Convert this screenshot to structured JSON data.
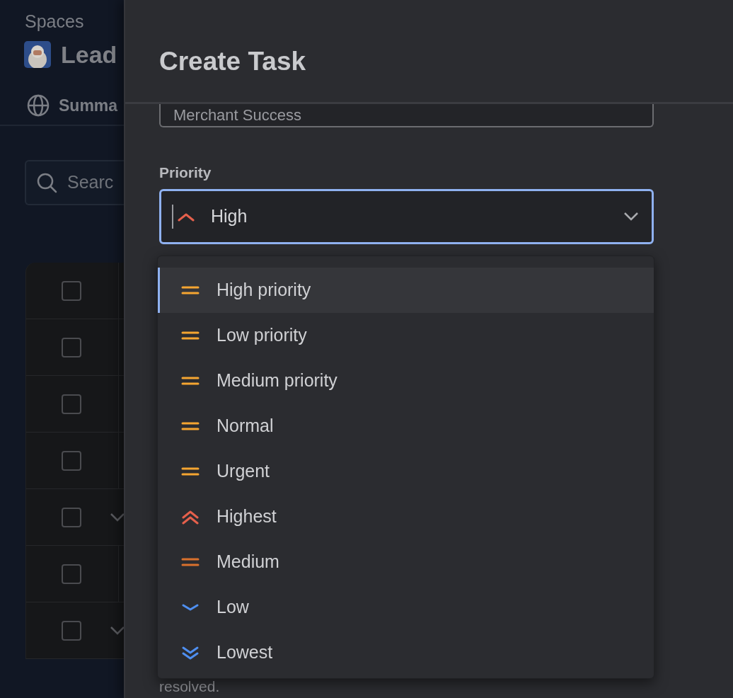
{
  "background": {
    "breadcrumb": "Spaces",
    "space_title": "Lead",
    "tab": "Summa",
    "search_placeholder": "Searc",
    "table_rows": [
      {
        "checked": false,
        "expandable": false
      },
      {
        "checked": false,
        "expandable": false
      },
      {
        "checked": false,
        "expandable": false
      },
      {
        "checked": false,
        "expandable": false
      },
      {
        "checked": false,
        "expandable": true
      },
      {
        "checked": false,
        "expandable": false
      },
      {
        "checked": false,
        "expandable": true
      }
    ]
  },
  "modal": {
    "title": "Create Task",
    "field_value": "Merchant Success",
    "priority_label": "Priority",
    "priority_value": {
      "label": "High",
      "kind": "up",
      "color": "#e5604c"
    },
    "options": [
      {
        "label": "High priority",
        "kind": "equal",
        "color": "#f5a531",
        "selected": true
      },
      {
        "label": "Low priority",
        "kind": "equal",
        "color": "#f5a531",
        "selected": false
      },
      {
        "label": "Medium priority",
        "kind": "equal",
        "color": "#f5a531",
        "selected": false
      },
      {
        "label": "Normal",
        "kind": "equal",
        "color": "#f5a531",
        "selected": false
      },
      {
        "label": "Urgent",
        "kind": "equal",
        "color": "#f5a531",
        "selected": false
      },
      {
        "label": "Highest",
        "kind": "double-up",
        "color": "#e5604c",
        "selected": false
      },
      {
        "label": "Medium",
        "kind": "equal",
        "color": "#d9712d",
        "selected": false
      },
      {
        "label": "Low",
        "kind": "down",
        "color": "#4f8ff0",
        "selected": false
      },
      {
        "label": "Lowest",
        "kind": "double-down",
        "color": "#4f8ff0",
        "selected": false
      }
    ],
    "footer_text": "resolved."
  }
}
